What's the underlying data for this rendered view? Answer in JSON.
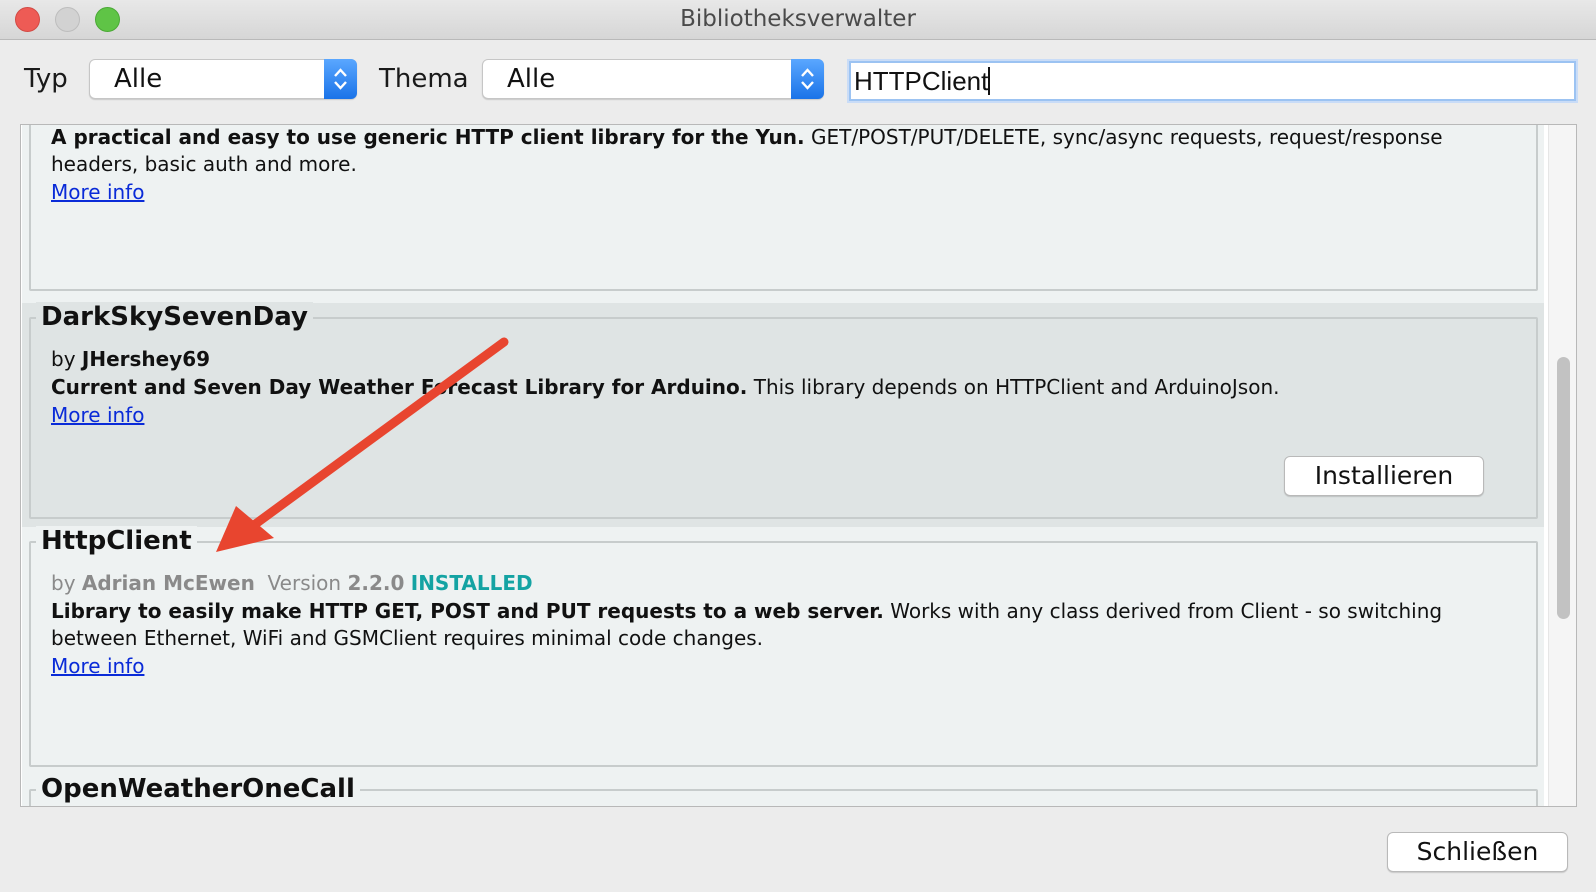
{
  "window": {
    "title": "Bibliotheksverwalter"
  },
  "toolbar": {
    "type_label": "Typ",
    "type_value": "Alle",
    "topic_label": "Thema",
    "topic_value": "Alle",
    "search_value": "HTTPClient"
  },
  "entries": [
    {
      "description_bold": "A practical and easy to use generic HTTP client library for the Yun.",
      "description_rest": " GET/POST/PUT/DELETE, sync/async requests, request/response",
      "description_line2": "headers, basic auth and more.",
      "more_info": "More info"
    },
    {
      "name": "DarkSkySevenDay",
      "by": "by",
      "author": "JHershey69",
      "description_bold": "Current and Seven Day Weather Forecast Library for Arduino.",
      "description_rest": " This library depends on HTTPClient and ArduinoJson.",
      "more_info": "More info",
      "install_label": "Installieren"
    },
    {
      "name": "HttpClient",
      "by": "by",
      "author": "Adrian McEwen",
      "version_label": "Version",
      "version": "2.2.0",
      "status": "INSTALLED",
      "description_bold": "Library to easily make HTTP GET, POST and PUT requests to a web server.",
      "description_rest": " Works with any class derived from Client - so switching",
      "description_line2": "between Ethernet, WiFi and GSMClient requires minimal code changes.",
      "more_info": "More info"
    },
    {
      "name": "OpenWeatherOneCall"
    }
  ],
  "footer": {
    "close_label": "Schließen"
  },
  "colors": {
    "installed": "#14a3a3",
    "link": "#0a2bd8",
    "annotation_arrow": "#e8452f",
    "accent_stepper": "#1a73e8"
  },
  "icons": {
    "dropdown": "chevron-updown-icon",
    "annotation": "red-arrow-icon"
  }
}
